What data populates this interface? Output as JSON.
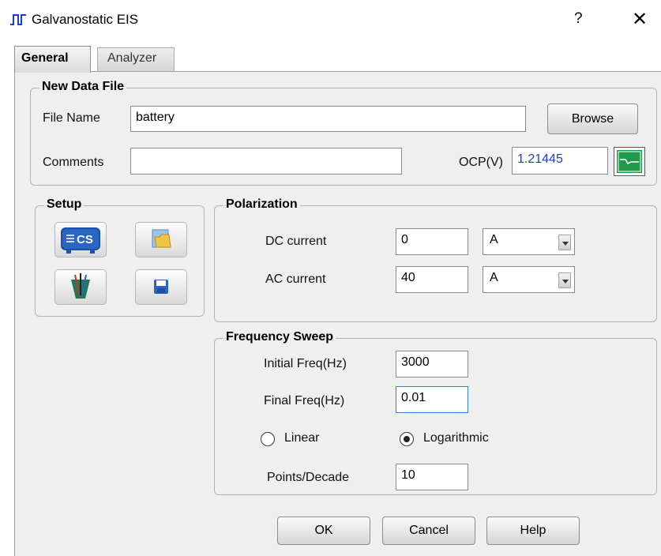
{
  "window": {
    "title": "Galvanostatic EIS",
    "help_glyph": "?",
    "close_glyph": "✕"
  },
  "tabs": [
    {
      "label": "General",
      "selected": true
    },
    {
      "label": "Analyzer",
      "selected": false
    }
  ],
  "new_data_file": {
    "legend": "New Data File",
    "file_name_label": "File Name",
    "file_name_value": "battery",
    "browse_label": "Browse",
    "comments_label": "Comments",
    "comments_value": "",
    "ocp_label": "OCP(V)",
    "ocp_value": "1.21445",
    "ocp_value_color": "#1a3fd6"
  },
  "setup": {
    "legend": "Setup",
    "cs_icon_text": "CS",
    "icons": [
      "cs-device-icon",
      "open-folder-icon",
      "electrode-icon",
      "save-icon"
    ]
  },
  "polarization": {
    "legend": "Polarization",
    "dc_label": "DC current",
    "dc_value": "0",
    "dc_unit": "A",
    "ac_label": "AC current",
    "ac_value": "40",
    "ac_unit": "A"
  },
  "frequency_sweep": {
    "legend": "Frequency Sweep",
    "initial_label": "Initial Freq(Hz)",
    "initial_value": "3000",
    "final_label": "Final Freq(Hz)",
    "final_value": "0.01",
    "linear_label": "Linear",
    "linear_selected": false,
    "log_label": "Logarithmic",
    "log_selected": true,
    "points_label": "Points/Decade",
    "points_value": "10"
  },
  "buttons": {
    "ok": "OK",
    "cancel": "Cancel",
    "help": "Help"
  },
  "colors": {
    "ocp_button_green": "#1f9a4a",
    "focus_border": "#3b78d8"
  }
}
